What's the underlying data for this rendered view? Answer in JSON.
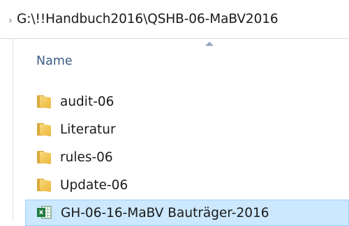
{
  "address_bar": {
    "path": "G:\\!!Handbuch2016\\QSHB-06-MaBV2016",
    "chevron": "›"
  },
  "column_header": {
    "name_label": "Name"
  },
  "items": [
    {
      "label": "audit-06",
      "icon": "folder-icon",
      "selected": false
    },
    {
      "label": "Literatur",
      "icon": "folder-icon",
      "selected": false
    },
    {
      "label": "rules-06",
      "icon": "folder-icon",
      "selected": false
    },
    {
      "label": "Update-06",
      "icon": "folder-icon",
      "selected": false
    },
    {
      "label": "GH-06-16-MaBV Bauträger-2016",
      "icon": "excel-icon",
      "selected": true
    }
  ],
  "colors": {
    "header_text": "#3d5d86",
    "selection_bg": "#cce8ff",
    "selection_border": "#99d1ff",
    "folder": "#f2c552",
    "excel": "#1f7a3e"
  }
}
